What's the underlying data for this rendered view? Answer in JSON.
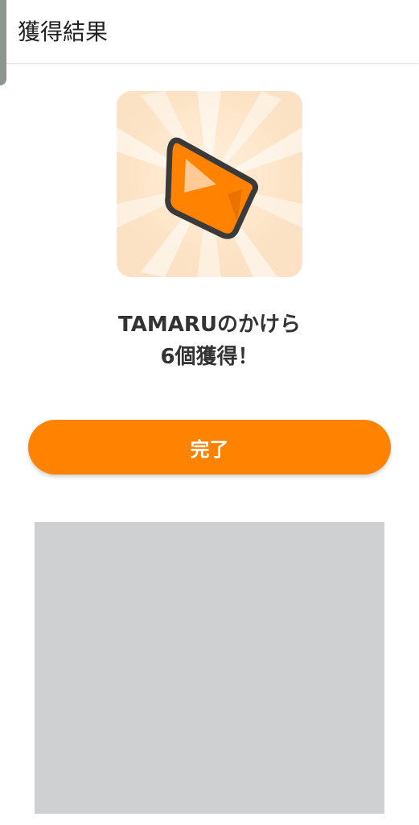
{
  "header": {
    "title": "獲得結果"
  },
  "reward": {
    "icon": "orange-gem-icon",
    "line1": "TAMARUのかけら",
    "line2": "6個獲得！"
  },
  "actions": {
    "complete_label": "完了"
  },
  "colors": {
    "accent": "#ff8200",
    "placeholder": "#cfd0d2"
  }
}
